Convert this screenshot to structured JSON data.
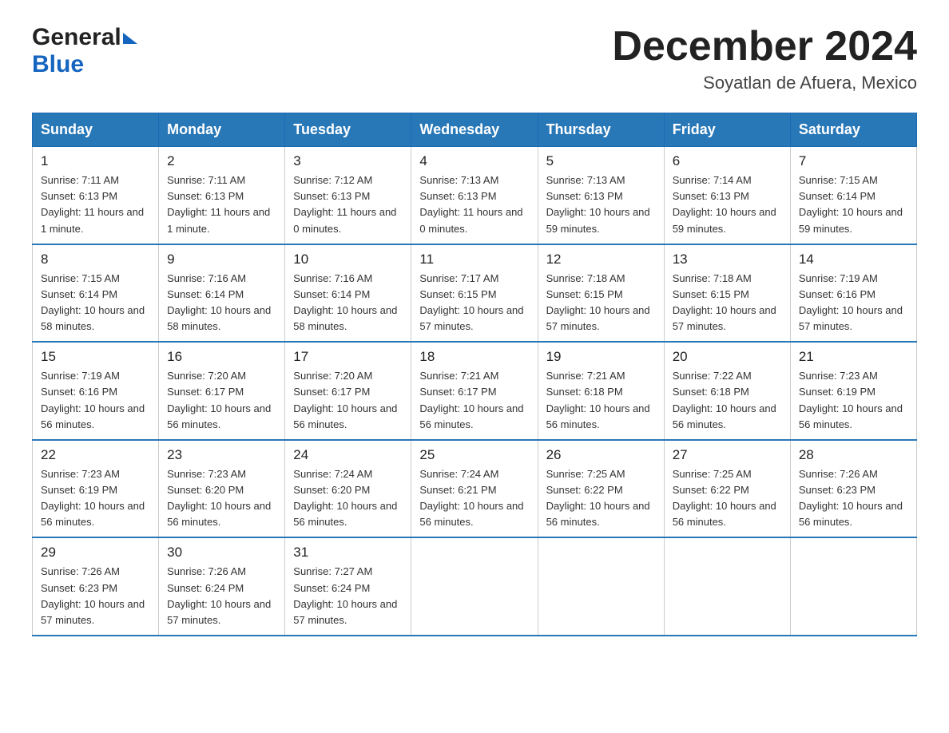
{
  "header": {
    "logo_general": "General",
    "logo_blue": "Blue",
    "month_year": "December 2024",
    "location": "Soyatlan de Afuera, Mexico"
  },
  "days_of_week": [
    "Sunday",
    "Monday",
    "Tuesday",
    "Wednesday",
    "Thursday",
    "Friday",
    "Saturday"
  ],
  "weeks": [
    [
      {
        "day": "1",
        "sunrise": "7:11 AM",
        "sunset": "6:13 PM",
        "daylight": "11 hours and 1 minute."
      },
      {
        "day": "2",
        "sunrise": "7:11 AM",
        "sunset": "6:13 PM",
        "daylight": "11 hours and 1 minute."
      },
      {
        "day": "3",
        "sunrise": "7:12 AM",
        "sunset": "6:13 PM",
        "daylight": "11 hours and 0 minutes."
      },
      {
        "day": "4",
        "sunrise": "7:13 AM",
        "sunset": "6:13 PM",
        "daylight": "11 hours and 0 minutes."
      },
      {
        "day": "5",
        "sunrise": "7:13 AM",
        "sunset": "6:13 PM",
        "daylight": "10 hours and 59 minutes."
      },
      {
        "day": "6",
        "sunrise": "7:14 AM",
        "sunset": "6:13 PM",
        "daylight": "10 hours and 59 minutes."
      },
      {
        "day": "7",
        "sunrise": "7:15 AM",
        "sunset": "6:14 PM",
        "daylight": "10 hours and 59 minutes."
      }
    ],
    [
      {
        "day": "8",
        "sunrise": "7:15 AM",
        "sunset": "6:14 PM",
        "daylight": "10 hours and 58 minutes."
      },
      {
        "day": "9",
        "sunrise": "7:16 AM",
        "sunset": "6:14 PM",
        "daylight": "10 hours and 58 minutes."
      },
      {
        "day": "10",
        "sunrise": "7:16 AM",
        "sunset": "6:14 PM",
        "daylight": "10 hours and 58 minutes."
      },
      {
        "day": "11",
        "sunrise": "7:17 AM",
        "sunset": "6:15 PM",
        "daylight": "10 hours and 57 minutes."
      },
      {
        "day": "12",
        "sunrise": "7:18 AM",
        "sunset": "6:15 PM",
        "daylight": "10 hours and 57 minutes."
      },
      {
        "day": "13",
        "sunrise": "7:18 AM",
        "sunset": "6:15 PM",
        "daylight": "10 hours and 57 minutes."
      },
      {
        "day": "14",
        "sunrise": "7:19 AM",
        "sunset": "6:16 PM",
        "daylight": "10 hours and 57 minutes."
      }
    ],
    [
      {
        "day": "15",
        "sunrise": "7:19 AM",
        "sunset": "6:16 PM",
        "daylight": "10 hours and 56 minutes."
      },
      {
        "day": "16",
        "sunrise": "7:20 AM",
        "sunset": "6:17 PM",
        "daylight": "10 hours and 56 minutes."
      },
      {
        "day": "17",
        "sunrise": "7:20 AM",
        "sunset": "6:17 PM",
        "daylight": "10 hours and 56 minutes."
      },
      {
        "day": "18",
        "sunrise": "7:21 AM",
        "sunset": "6:17 PM",
        "daylight": "10 hours and 56 minutes."
      },
      {
        "day": "19",
        "sunrise": "7:21 AM",
        "sunset": "6:18 PM",
        "daylight": "10 hours and 56 minutes."
      },
      {
        "day": "20",
        "sunrise": "7:22 AM",
        "sunset": "6:18 PM",
        "daylight": "10 hours and 56 minutes."
      },
      {
        "day": "21",
        "sunrise": "7:23 AM",
        "sunset": "6:19 PM",
        "daylight": "10 hours and 56 minutes."
      }
    ],
    [
      {
        "day": "22",
        "sunrise": "7:23 AM",
        "sunset": "6:19 PM",
        "daylight": "10 hours and 56 minutes."
      },
      {
        "day": "23",
        "sunrise": "7:23 AM",
        "sunset": "6:20 PM",
        "daylight": "10 hours and 56 minutes."
      },
      {
        "day": "24",
        "sunrise": "7:24 AM",
        "sunset": "6:20 PM",
        "daylight": "10 hours and 56 minutes."
      },
      {
        "day": "25",
        "sunrise": "7:24 AM",
        "sunset": "6:21 PM",
        "daylight": "10 hours and 56 minutes."
      },
      {
        "day": "26",
        "sunrise": "7:25 AM",
        "sunset": "6:22 PM",
        "daylight": "10 hours and 56 minutes."
      },
      {
        "day": "27",
        "sunrise": "7:25 AM",
        "sunset": "6:22 PM",
        "daylight": "10 hours and 56 minutes."
      },
      {
        "day": "28",
        "sunrise": "7:26 AM",
        "sunset": "6:23 PM",
        "daylight": "10 hours and 56 minutes."
      }
    ],
    [
      {
        "day": "29",
        "sunrise": "7:26 AM",
        "sunset": "6:23 PM",
        "daylight": "10 hours and 57 minutes."
      },
      {
        "day": "30",
        "sunrise": "7:26 AM",
        "sunset": "6:24 PM",
        "daylight": "10 hours and 57 minutes."
      },
      {
        "day": "31",
        "sunrise": "7:27 AM",
        "sunset": "6:24 PM",
        "daylight": "10 hours and 57 minutes."
      },
      null,
      null,
      null,
      null
    ]
  ]
}
